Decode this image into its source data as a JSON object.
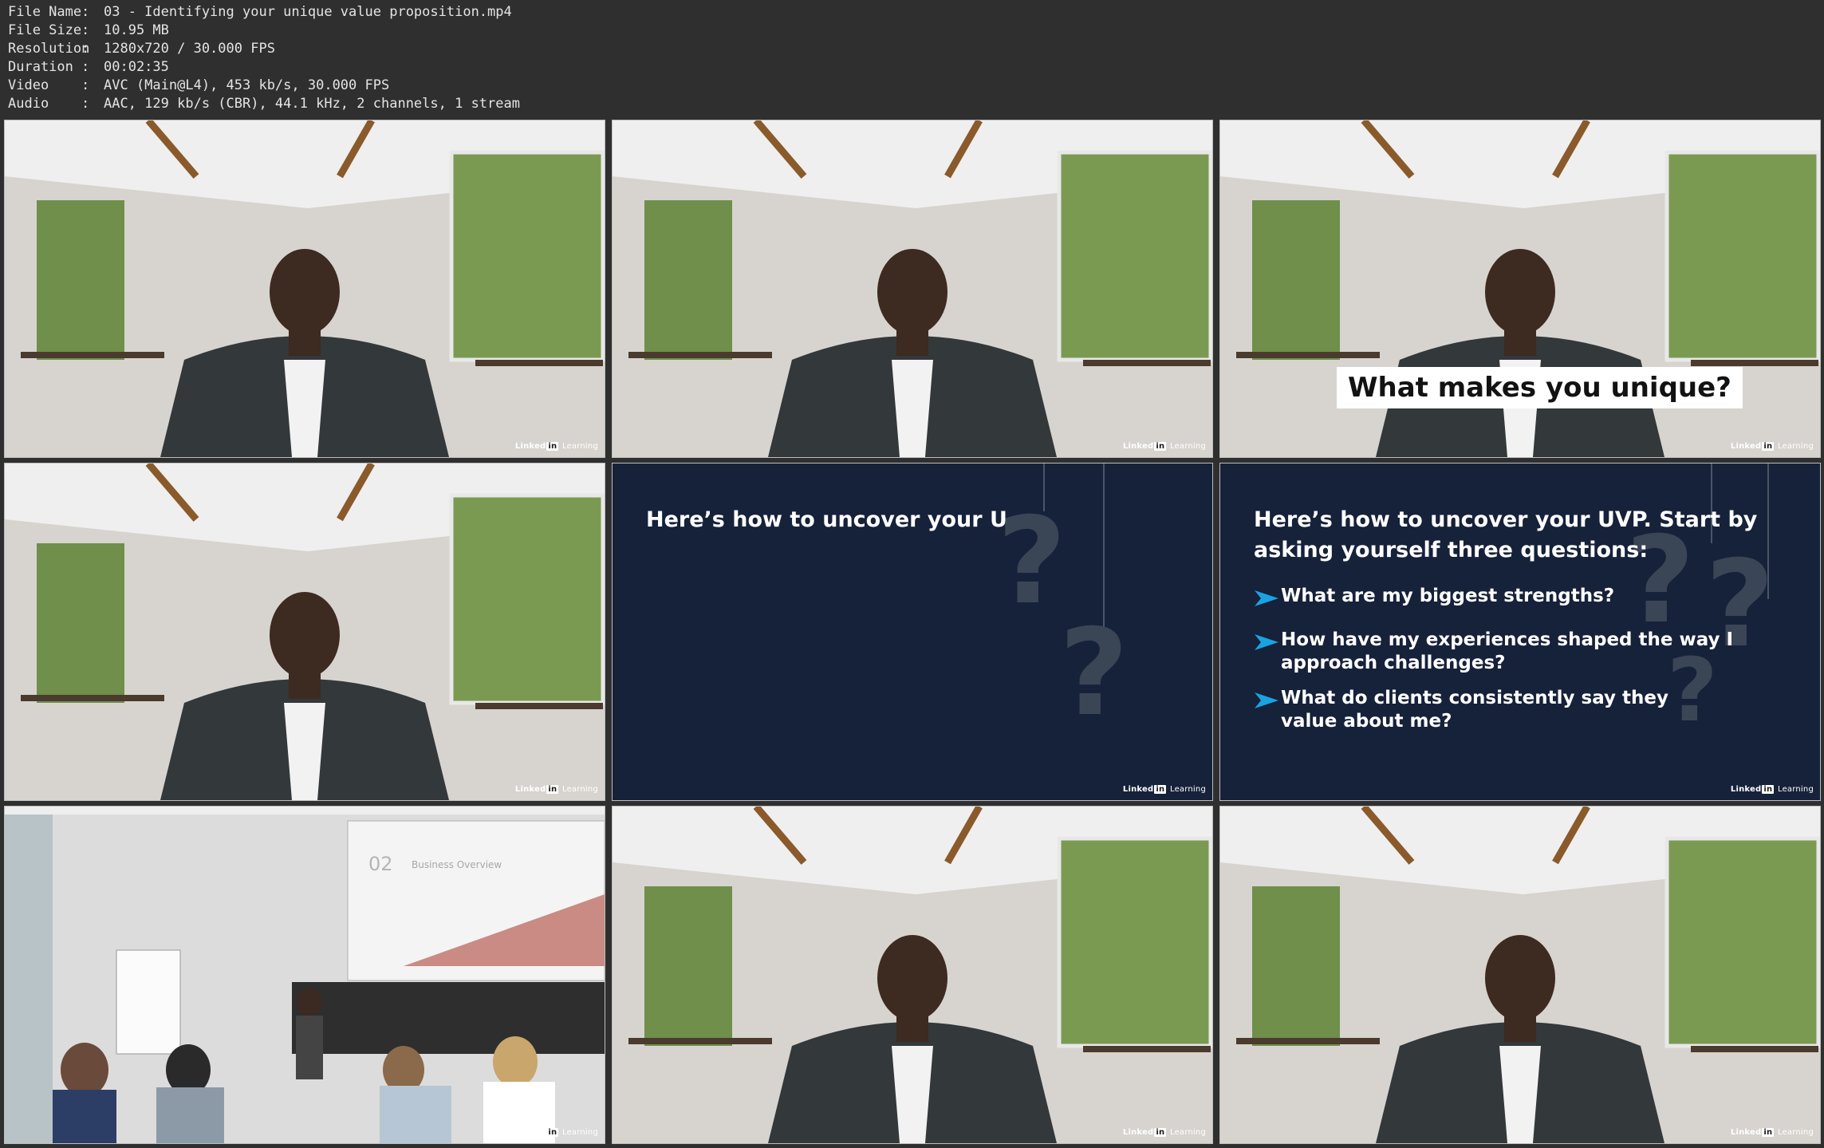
{
  "file_info": [
    {
      "key": "File Name",
      "value": "03 - Identifying your unique value proposition.mp4"
    },
    {
      "key": "File Size",
      "value": "10.95 MB"
    },
    {
      "key": "Resolution",
      "value": "1280x720 / 30.000 FPS"
    },
    {
      "key": "Duration",
      "value": "00:02:35"
    },
    {
      "key": "Video",
      "value": "AVC (Main@L4), 453 kb/s, 30.000 FPS"
    },
    {
      "key": "Audio",
      "value": "AAC, 129 kb/s (CBR), 44.1 kHz, 2 channels, 1 stream"
    }
  ],
  "separator": ":",
  "watermark": {
    "brand": "Linked",
    "in": "in",
    "product": "Learning"
  },
  "captions": {
    "frame3": "What makes you unique?"
  },
  "slides": {
    "frame5_title": "Here’s how to uncover your U",
    "frame6_title_line1": "Here’s how to uncover your UVP. Start by",
    "frame6_title_line2": "asking yourself three questions:",
    "questions": [
      {
        "line1": "What are my biggest strengths?",
        "line2": ""
      },
      {
        "line1": "How have my experiences shaped the way I",
        "line2": "approach challenges?"
      },
      {
        "line1": "What do clients consistently say they",
        "line2": "value about me?"
      }
    ],
    "qmark": "?"
  },
  "projector": {
    "number": "02",
    "title": "Business Overview"
  },
  "colors": {
    "slide_bg": "#16213a",
    "bullet_arrow": "#1aa3e0",
    "background": "#2f2f2f"
  }
}
